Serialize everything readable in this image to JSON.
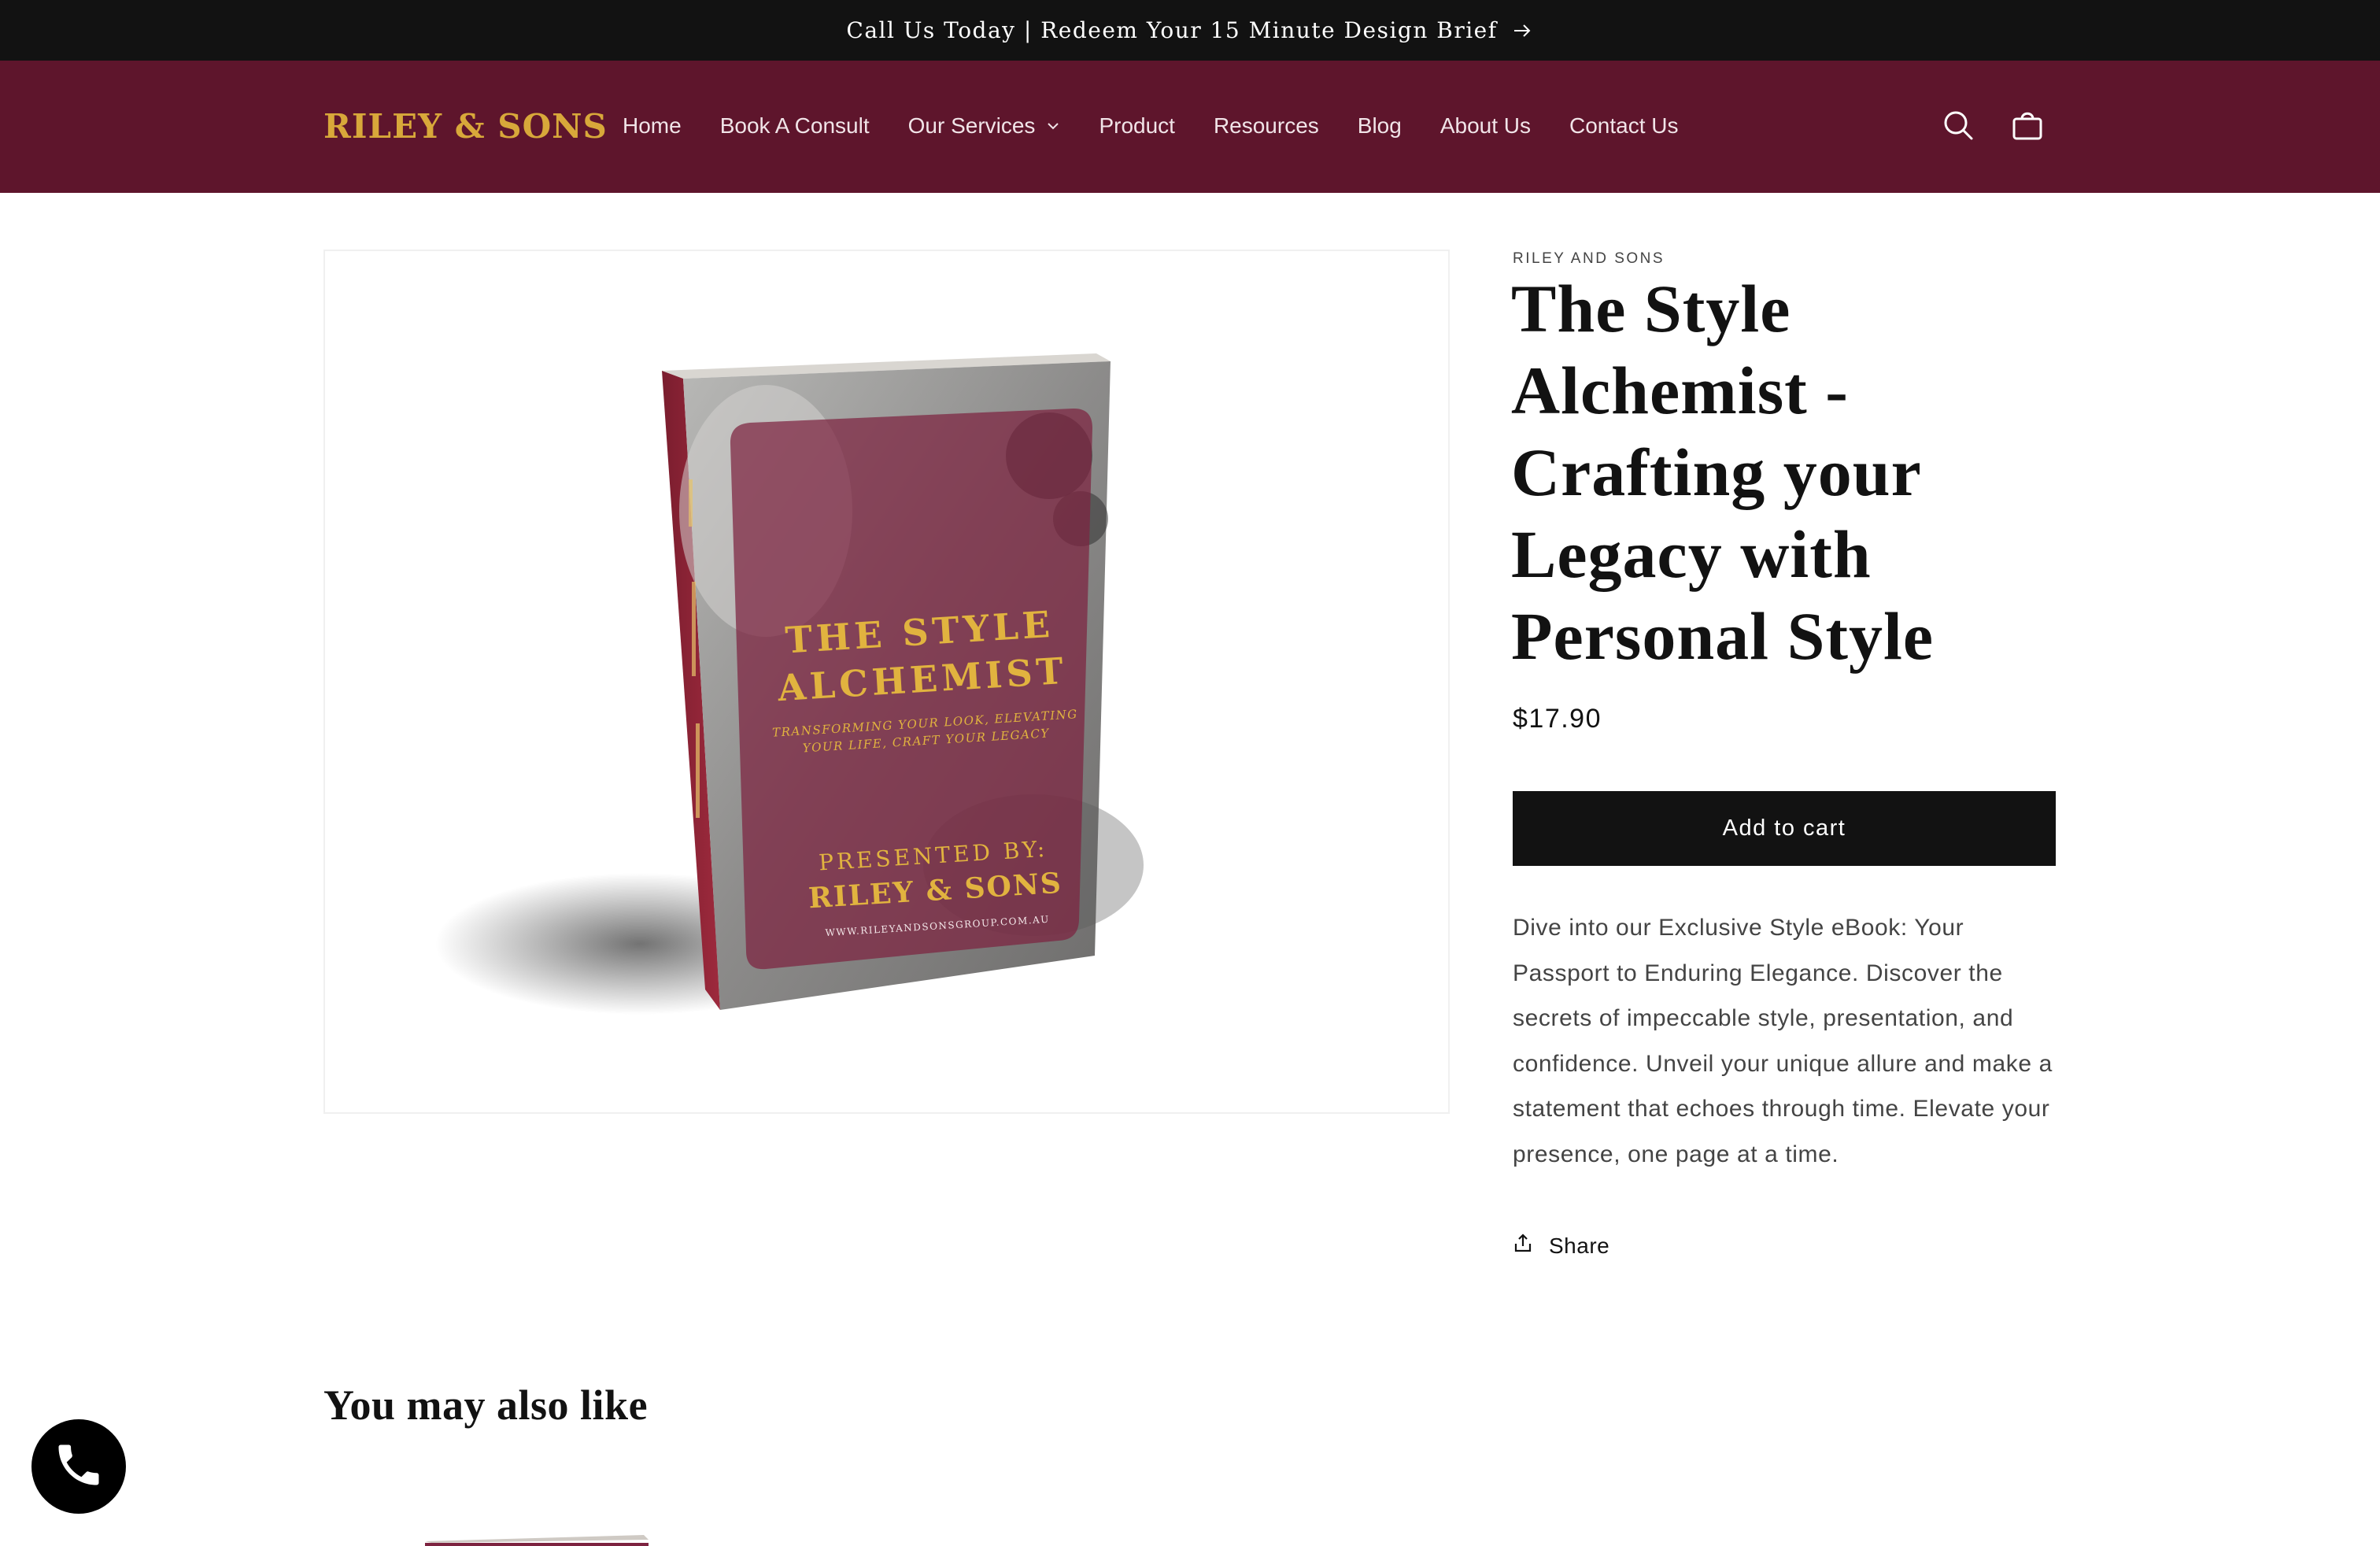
{
  "announcement": {
    "text": "Call Us Today | Redeem Your 15 Minute Design Brief"
  },
  "header": {
    "logo_text": "RILEY & SONS",
    "nav": [
      {
        "label": "Home"
      },
      {
        "label": "Book A Consult"
      },
      {
        "label": "Our Services",
        "has_dropdown": true
      },
      {
        "label": "Product"
      },
      {
        "label": "Resources"
      },
      {
        "label": "Blog"
      },
      {
        "label": "About Us"
      },
      {
        "label": "Contact Us"
      }
    ],
    "icons": [
      "search-icon",
      "cart-icon"
    ]
  },
  "product": {
    "vendor": "RILEY AND SONS",
    "title": "The Style Alchemist - Crafting your Legacy with Personal Style",
    "price": "$17.90",
    "add_to_cart": "Add to cart",
    "description": "Dive into our Exclusive Style eBook: Your Passport to Enduring Elegance. Discover the secrets of impeccable style, presentation, and confidence. Unveil your unique allure and make a statement that echoes through time. Elevate your presence, one page at a time.",
    "share_label": "Share",
    "cover": {
      "title_line1": "THE STYLE",
      "title_line2": "ALCHEMIST",
      "tagline_line1": "TRANSFORMING YOUR LOOK, ELEVATING",
      "tagline_line2": "YOUR LIFE, CRAFT YOUR LEGACY",
      "presented_by": "PRESENTED BY:",
      "brand": "RILEY & SONS",
      "website": "WWW.RILEYANDSONSGROUP.COM.AU"
    }
  },
  "related": {
    "heading": "You may also like"
  },
  "colors": {
    "announcement_bg": "#121212",
    "header_bg": "#5e152c",
    "logo_gold": "#d8a83a",
    "button_bg": "#121212",
    "cover_maroon": "#7d2340"
  }
}
